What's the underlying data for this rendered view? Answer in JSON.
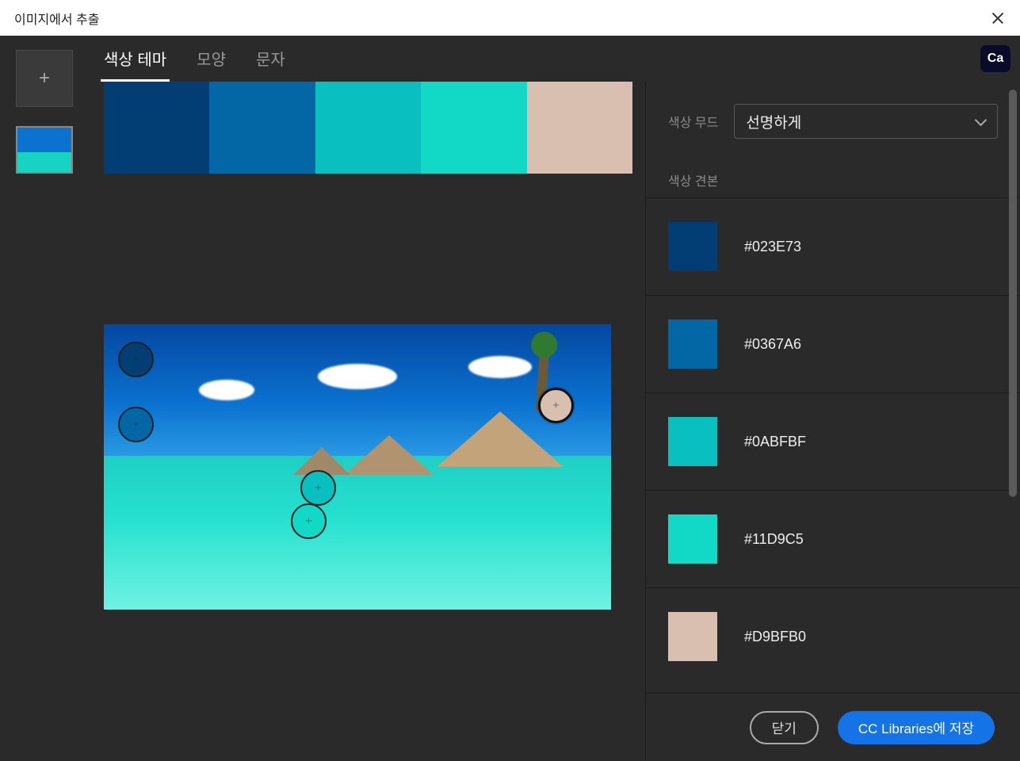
{
  "titlebar": {
    "title": "이미지에서 추출"
  },
  "tabs": {
    "t0": "색상 테마",
    "t1": "모양",
    "t2": "문자"
  },
  "badge": {
    "ca": "Ca"
  },
  "palette": {
    "c0": "#023E73",
    "c1": "#0367A6",
    "c2": "#0ABFBF",
    "c3": "#11D9C5",
    "c4": "#D9BFB0"
  },
  "side": {
    "mood_label": "색상 무드",
    "mood_value": "선명하게",
    "swatch_section": "색상 견본",
    "swatches": {
      "s0": {
        "hex": "#023E73"
      },
      "s1": {
        "hex": "#0367A6"
      },
      "s2": {
        "hex": "#0ABFBF"
      },
      "s3": {
        "hex": "#11D9C5"
      },
      "s4": {
        "hex": "#D9BFB0"
      }
    }
  },
  "footer": {
    "close": "닫기",
    "save": "CC Libraries에 저장"
  }
}
